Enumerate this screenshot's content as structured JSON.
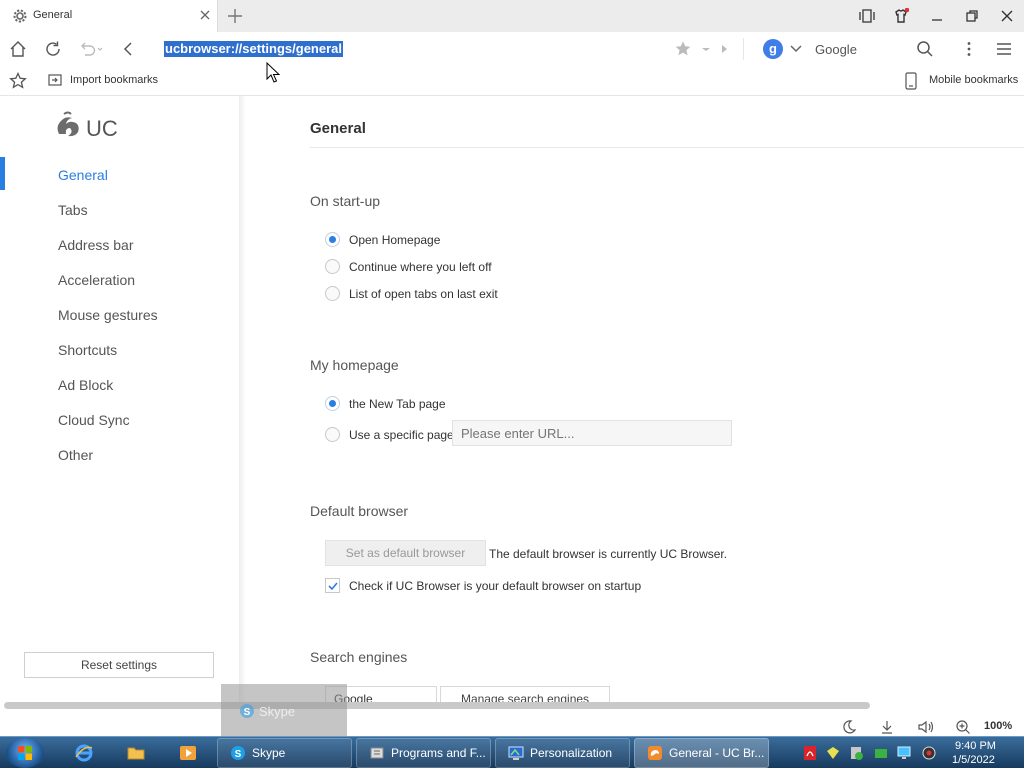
{
  "browser": {
    "tab": {
      "title": "General"
    },
    "address": {
      "url": "ucbrowser://settings/general"
    },
    "search": {
      "engine": "Google",
      "engine_badge": "g"
    },
    "bookmarks_bar": {
      "import_label": "Import bookmarks",
      "mobile_label": "Mobile bookmarks"
    },
    "status": {
      "zoom": "100%"
    }
  },
  "sidebar": {
    "logo_text": "UC",
    "items": [
      {
        "label": "General",
        "active": true
      },
      {
        "label": "Tabs"
      },
      {
        "label": "Address bar"
      },
      {
        "label": "Acceleration"
      },
      {
        "label": "Mouse gestures"
      },
      {
        "label": "Shortcuts"
      },
      {
        "label": "Ad Block"
      },
      {
        "label": "Cloud Sync"
      },
      {
        "label": "Other"
      }
    ],
    "reset_label": "Reset settings"
  },
  "main": {
    "title": "General",
    "startup": {
      "heading": "On start-up",
      "options": [
        {
          "label": "Open Homepage",
          "selected": true
        },
        {
          "label": "Continue where you left off",
          "selected": false
        },
        {
          "label": "List of open tabs on last exit",
          "selected": false
        }
      ]
    },
    "homepage": {
      "heading": "My homepage",
      "options": [
        {
          "label": "the New Tab page",
          "selected": true
        },
        {
          "label": "Use a specific page",
          "selected": false
        }
      ],
      "url_placeholder": "Please enter URL..."
    },
    "default_browser": {
      "heading": "Default browser",
      "button_label": "Set as default browser",
      "status_text": "The default browser is currently UC Browser.",
      "check_label": "Check if UC Browser is your default browser on startup",
      "checked": true
    },
    "search_engines": {
      "heading": "Search engines",
      "selected_engine": "Google",
      "manage_label": "Manage search engines"
    }
  },
  "skype_ghost": {
    "label": "Skype"
  },
  "taskbar": {
    "tasks": [
      {
        "label": "Skype"
      },
      {
        "label": "Programs and F..."
      },
      {
        "label": "Personalization"
      },
      {
        "label": "General - UC Br..."
      }
    ],
    "clock": {
      "time": "9:40 PM",
      "date": "1/5/2022"
    }
  },
  "colors": {
    "accent": "#2a7de1",
    "selection": "#2f6fce",
    "taskbar": "#1f4a75"
  }
}
